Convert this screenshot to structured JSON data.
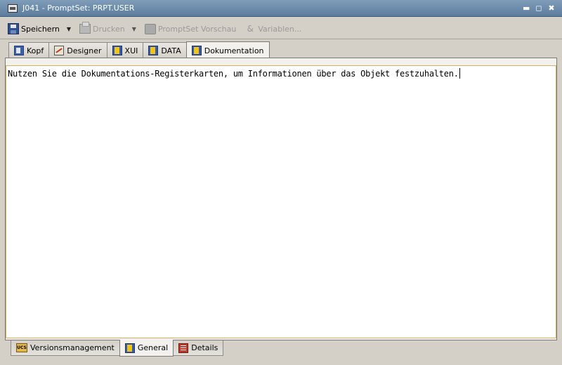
{
  "window": {
    "title": "J041 - PromptSet: PRPT.USER",
    "controls": {
      "minimize": "▬",
      "maximize": "◻",
      "close": "✖"
    }
  },
  "toolbar": {
    "save_label": "Speichern",
    "print_label": "Drucken",
    "preview_label": "PromptSet Vorschau",
    "variables_label": "Variablen..."
  },
  "tabs_top": [
    {
      "label": "Kopf",
      "icon": "info-icon",
      "active": false
    },
    {
      "label": "Designer",
      "icon": "designer-icon",
      "active": false
    },
    {
      "label": "XUI",
      "icon": "book-icon",
      "active": false
    },
    {
      "label": "DATA",
      "icon": "book-icon",
      "active": false
    },
    {
      "label": "Dokumentation",
      "icon": "book-icon",
      "active": true
    }
  ],
  "editor": {
    "text": "Nutzen Sie die Dokumentations-Registerkarten, um Informationen über das Objekt festzuhalten."
  },
  "tabs_bottom": [
    {
      "label": "Versionsmanagement",
      "icon": "ucs-icon",
      "icon_text": "UCS",
      "active": false
    },
    {
      "label": "General",
      "icon": "book-icon",
      "active": true
    },
    {
      "label": "Details",
      "icon": "details-icon",
      "active": false
    }
  ],
  "colors": {
    "titlebar": "#5d7d9e",
    "editor_border": "#d6b35a",
    "background": "#d4d0c8"
  }
}
